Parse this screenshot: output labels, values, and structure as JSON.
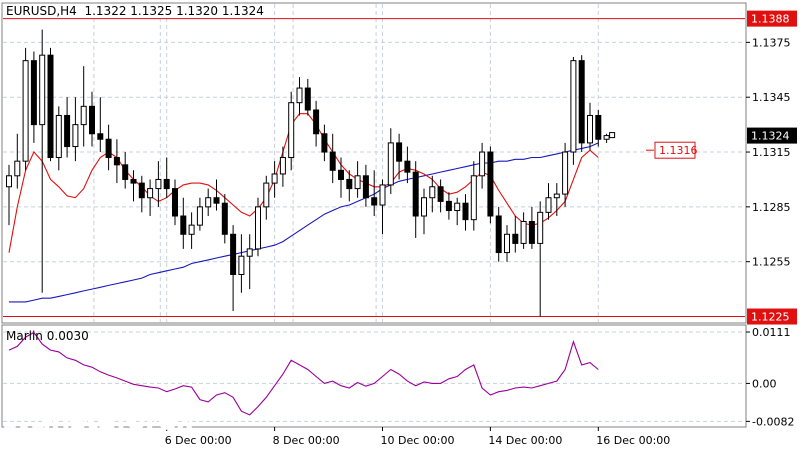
{
  "header": {
    "symbol": "EURUSD,H4",
    "ohlc": "1.1322 1.1325 1.1320 1.1324"
  },
  "indicator": {
    "name": "Marlin",
    "value": "0.0030"
  },
  "logo": {
    "name": "instaforex",
    "tagline": "Instant Forex Trading"
  },
  "colors": {
    "candle": "#000000",
    "ma_fast": "#e01010",
    "ma_slow": "#1818c0",
    "level_line": "#e01010",
    "oscillator": "#990099",
    "grid": "#c8d0dc",
    "axis": "#808080"
  },
  "chart_data": [
    {
      "type": "candlestick",
      "title": "EURUSD,H4",
      "ylim": [
        1.1222,
        1.1396
      ],
      "y_ticks": [
        "1.1375",
        "1.1345",
        "1.1315",
        "1.1285",
        "1.1255"
      ],
      "x_labels": [
        "6 Dec 00:00",
        "8 Dec 00:00",
        "10 Dec 00:00",
        "14 Dec 00:00",
        "16 Dec 00:00"
      ],
      "x_label_index": [
        19,
        32,
        45,
        58,
        71
      ],
      "levels": [
        {
          "value": 1.1388,
          "label": "1.1388"
        },
        {
          "value": 1.1225,
          "label": "1.1225"
        }
      ],
      "current_price": {
        "value": 1.1324,
        "label": "1.1324"
      },
      "target": {
        "value": 1.1316,
        "label": "1.1316"
      },
      "candles": [
        [
          1.1296,
          1.1308,
          1.1275,
          1.1302
        ],
        [
          1.1302,
          1.1325,
          1.1295,
          1.131
        ],
        [
          1.131,
          1.1372,
          1.1305,
          1.1365
        ],
        [
          1.1365,
          1.137,
          1.132,
          1.133
        ],
        [
          1.133,
          1.1382,
          1.1238,
          1.1368
        ],
        [
          1.1368,
          1.1372,
          1.131,
          1.1312
        ],
        [
          1.1312,
          1.134,
          1.1305,
          1.1335
        ],
        [
          1.1335,
          1.1345,
          1.1312,
          1.1318
        ],
        [
          1.1318,
          1.1345,
          1.131,
          1.133
        ],
        [
          1.133,
          1.1362,
          1.1318,
          1.134
        ],
        [
          1.134,
          1.1348,
          1.1318,
          1.1325
        ],
        [
          1.1325,
          1.1345,
          1.1315,
          1.1322
        ],
        [
          1.1322,
          1.133,
          1.1305,
          1.1312
        ],
        [
          1.1312,
          1.1322,
          1.1298,
          1.1308
        ],
        [
          1.1308,
          1.1315,
          1.1295,
          1.13
        ],
        [
          1.13,
          1.1305,
          1.1288,
          1.1298
        ],
        [
          1.1298,
          1.1302,
          1.1282,
          1.129
        ],
        [
          1.129,
          1.13,
          1.128,
          1.1295
        ],
        [
          1.1295,
          1.131,
          1.1285,
          1.13
        ],
        [
          1.13,
          1.1312,
          1.129,
          1.1295
        ],
        [
          1.1295,
          1.13,
          1.1275,
          1.128
        ],
        [
          1.128,
          1.129,
          1.1262,
          1.127
        ],
        [
          1.127,
          1.1282,
          1.1262,
          1.1275
        ],
        [
          1.1275,
          1.129,
          1.1272,
          1.1285
        ],
        [
          1.1285,
          1.1295,
          1.128,
          1.129
        ],
        [
          1.129,
          1.13,
          1.1283,
          1.1287
        ],
        [
          1.1287,
          1.1292,
          1.1265,
          1.127
        ],
        [
          1.127,
          1.1275,
          1.1228,
          1.1248
        ],
        [
          1.1248,
          1.127,
          1.1238,
          1.1258
        ],
        [
          1.1258,
          1.127,
          1.124,
          1.1262
        ],
        [
          1.1262,
          1.129,
          1.1258,
          1.1285
        ],
        [
          1.1285,
          1.1302,
          1.1278,
          1.1298
        ],
        [
          1.1298,
          1.131,
          1.129,
          1.1303
        ],
        [
          1.1303,
          1.1318,
          1.1296,
          1.1312
        ],
        [
          1.1312,
          1.1348,
          1.1305,
          1.1342
        ],
        [
          1.1342,
          1.1356,
          1.1335,
          1.135
        ],
        [
          1.135,
          1.1355,
          1.1335,
          1.1338
        ],
        [
          1.1338,
          1.1343,
          1.1318,
          1.1325
        ],
        [
          1.1325,
          1.133,
          1.131,
          1.1315
        ],
        [
          1.1315,
          1.1325,
          1.1298,
          1.1305
        ],
        [
          1.1305,
          1.1312,
          1.129,
          1.13
        ],
        [
          1.13,
          1.1305,
          1.1288,
          1.1295
        ],
        [
          1.1295,
          1.131,
          1.129,
          1.1302
        ],
        [
          1.1302,
          1.1308,
          1.1285,
          1.129
        ],
        [
          1.129,
          1.1305,
          1.128,
          1.1286
        ],
        [
          1.1286,
          1.13,
          1.127,
          1.1297
        ],
        [
          1.1297,
          1.1328,
          1.1292,
          1.132
        ],
        [
          1.132,
          1.1325,
          1.13,
          1.131
        ],
        [
          1.131,
          1.1318,
          1.1298,
          1.1304
        ],
        [
          1.1304,
          1.131,
          1.1268,
          1.128
        ],
        [
          1.128,
          1.1295,
          1.127,
          1.129
        ],
        [
          1.129,
          1.1302,
          1.1282,
          1.1296
        ],
        [
          1.1296,
          1.13,
          1.1282,
          1.1288
        ],
        [
          1.1288,
          1.1293,
          1.1278,
          1.1283
        ],
        [
          1.1283,
          1.129,
          1.1275,
          1.1287
        ],
        [
          1.1287,
          1.1292,
          1.1272,
          1.1278
        ],
        [
          1.1278,
          1.131,
          1.1272,
          1.1302
        ],
        [
          1.1302,
          1.132,
          1.1295,
          1.1315
        ],
        [
          1.1315,
          1.1318,
          1.1276,
          1.128
        ],
        [
          1.128,
          1.1285,
          1.1255,
          1.126
        ],
        [
          1.126,
          1.1275,
          1.1255,
          1.127
        ],
        [
          1.127,
          1.128,
          1.126,
          1.1265
        ],
        [
          1.1265,
          1.1282,
          1.1262,
          1.1277
        ],
        [
          1.1277,
          1.1285,
          1.1262,
          1.1265
        ],
        [
          1.1265,
          1.1288,
          1.1225,
          1.1282
        ],
        [
          1.1282,
          1.1298,
          1.1278,
          1.129
        ],
        [
          1.129,
          1.1298,
          1.128,
          1.1292
        ],
        [
          1.1292,
          1.132,
          1.1285,
          1.1315
        ],
        [
          1.1315,
          1.1367,
          1.1308,
          1.1365
        ],
        [
          1.1365,
          1.1368,
          1.1315,
          1.132
        ],
        [
          1.132,
          1.1342,
          1.1316,
          1.1335
        ],
        [
          1.1335,
          1.1338,
          1.1318,
          1.1322
        ],
        [
          1.1322,
          1.1325,
          1.132,
          1.1324
        ]
      ],
      "ma_fast": [
        1.126,
        1.1285,
        1.1305,
        1.1315,
        1.131,
        1.13,
        1.1296,
        1.1291,
        1.129,
        1.1295,
        1.1305,
        1.1312,
        1.1315,
        1.1312,
        1.1305,
        1.13,
        1.1296,
        1.1291,
        1.1288,
        1.129,
        1.1294,
        1.1297,
        1.1298,
        1.1298,
        1.1297,
        1.1294,
        1.129,
        1.1286,
        1.1282,
        1.128,
        1.1284,
        1.129,
        1.13,
        1.1315,
        1.133,
        1.1336,
        1.1336,
        1.133,
        1.1322,
        1.1315,
        1.1308,
        1.1303,
        1.13,
        1.1298,
        1.1296,
        1.1296,
        1.1298,
        1.1304,
        1.1306,
        1.1305,
        1.1303,
        1.13,
        1.1295,
        1.1292,
        1.1293,
        1.1296,
        1.13,
        1.1304,
        1.1302,
        1.1294,
        1.1287,
        1.128,
        1.1276,
        1.1275,
        1.1276,
        1.1279,
        1.1283,
        1.1288,
        1.13,
        1.1312,
        1.1316,
        1.1312
      ],
      "ma_slow": [
        1.1233,
        1.1233,
        1.1233,
        1.1234,
        1.1235,
        1.1235,
        1.1236,
        1.1237,
        1.1238,
        1.1239,
        1.124,
        1.1241,
        1.1242,
        1.1243,
        1.1244,
        1.1245,
        1.1246,
        1.1248,
        1.1249,
        1.125,
        1.1251,
        1.1252,
        1.1254,
        1.1255,
        1.1256,
        1.1257,
        1.1258,
        1.1259,
        1.126,
        1.1261,
        1.1262,
        1.1263,
        1.1264,
        1.1266,
        1.1269,
        1.1272,
        1.1275,
        1.1278,
        1.1281,
        1.1283,
        1.1285,
        1.1286,
        1.1288,
        1.129,
        1.1292,
        1.1295,
        1.1297,
        1.1299,
        1.13,
        1.1301,
        1.1302,
        1.1303,
        1.1304,
        1.1305,
        1.1306,
        1.1307,
        1.1308,
        1.1309,
        1.1309,
        1.131,
        1.131,
        1.1311,
        1.1311,
        1.1312,
        1.1312,
        1.1313,
        1.1314,
        1.1315,
        1.1316,
        1.1317,
        1.1318,
        1.132
      ]
    },
    {
      "type": "line",
      "title": "Marlin 0.0030",
      "ylim": [
        -0.0092,
        0.0124
      ],
      "y_ticks": [
        "0.0111",
        "0.00",
        "-0.0082"
      ],
      "values": [
        0.0072,
        0.008,
        0.01,
        0.011,
        0.0085,
        0.0072,
        0.0068,
        0.0055,
        0.005,
        0.004,
        0.0035,
        0.0025,
        0.0018,
        0.0012,
        0.0005,
        -0.0002,
        -0.0005,
        -0.0008,
        -0.001,
        -0.0018,
        -0.0012,
        -0.0005,
        -0.0008,
        -0.0035,
        -0.004,
        -0.0025,
        -0.002,
        -0.003,
        -0.006,
        -0.0068,
        -0.005,
        -0.003,
        -0.0005,
        0.002,
        0.005,
        0.004,
        0.003,
        0.0015,
        0.0,
        0.0005,
        -0.0005,
        -0.001,
        0.0002,
        -0.0006,
        0.0,
        0.0015,
        0.003,
        0.002,
        0.0005,
        -0.0005,
        0.0003,
        0.0,
        0.0,
        0.001,
        0.0015,
        0.003,
        0.004,
        -0.001,
        -0.0025,
        -0.0018,
        -0.0015,
        -0.001,
        -0.0008,
        -0.001,
        -0.0005,
        0.0,
        0.0005,
        0.003,
        0.009,
        0.004,
        0.0045,
        0.003
      ]
    }
  ]
}
